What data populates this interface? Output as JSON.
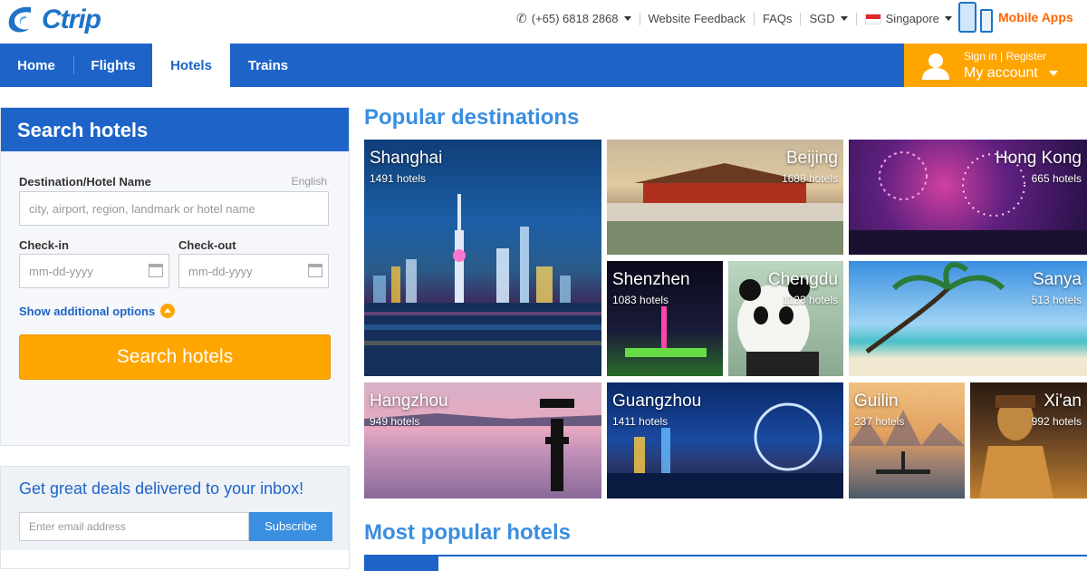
{
  "brand": {
    "name": "Ctrip"
  },
  "topbar": {
    "phone": "(+65) 6818 2868",
    "feedback": "Website Feedback",
    "faqs": "FAQs",
    "currency": "SGD",
    "country": "Singapore",
    "mobile_apps": "Mobile Apps"
  },
  "nav": {
    "tabs": [
      {
        "label": "Home"
      },
      {
        "label": "Flights"
      },
      {
        "label": "Hotels",
        "active": true
      },
      {
        "label": "Trains"
      }
    ],
    "account": {
      "signin": "Sign in | Register",
      "label": "My account"
    }
  },
  "search": {
    "title": "Search hotels",
    "dest_label": "Destination/Hotel Name",
    "lang": "English",
    "dest_placeholder": "city, airport, region, landmark or hotel name",
    "checkin_label": "Check-in",
    "checkout_label": "Check-out",
    "date_placeholder": "mm-dd-yyyy",
    "additional": "Show additional options",
    "button": "Search hotels"
  },
  "deals": {
    "title": "Get great deals delivered to your inbox!",
    "email_placeholder": "Enter email address",
    "button": "Subscribe"
  },
  "popular": {
    "title": "Popular destinations",
    "items": [
      {
        "name": "Shanghai",
        "count": "1491 hotels"
      },
      {
        "name": "Beijing",
        "count": "1688 hotels"
      },
      {
        "name": "Hong Kong",
        "count": "665 hotels"
      },
      {
        "name": "Shenzhen",
        "count": "1083 hotels"
      },
      {
        "name": "Chengdu",
        "count": "1123 hotels"
      },
      {
        "name": "Sanya",
        "count": "513 hotels"
      },
      {
        "name": "Hangzhou",
        "count": "949 hotels"
      },
      {
        "name": "Guangzhou",
        "count": "1411 hotels"
      },
      {
        "name": "Guilin",
        "count": "237 hotels"
      },
      {
        "name": "Xi'an",
        "count": "992 hotels"
      }
    ]
  },
  "most_popular": {
    "title": "Most popular hotels"
  }
}
